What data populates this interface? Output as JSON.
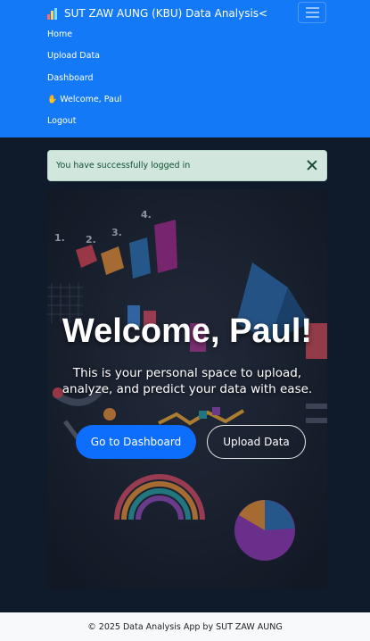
{
  "navbar": {
    "brand_text": "SUT ZAW AUNG (KBU) Data Analysis<",
    "brand_icon": "bar-chart-icon",
    "links": [
      {
        "label": "Home"
      },
      {
        "label": "Upload Data"
      },
      {
        "label": "Dashboard"
      },
      {
        "label": "Welcome, Paul",
        "icon": "waving-hand-icon"
      },
      {
        "label": "Logout"
      }
    ],
    "toggler_icon": "hamburger-menu-icon"
  },
  "alert": {
    "message": "You have successfully logged in",
    "close_icon": "close-icon"
  },
  "hero": {
    "title": "Welcome, Paul!",
    "subtitle": "This is your personal space to upload, analyze, and predict your data with ease.",
    "primary_button": "Go to Dashboard",
    "secondary_button": "Upload Data",
    "image_numbers": [
      "1.",
      "2.",
      "3.",
      "4."
    ]
  },
  "footer": {
    "text": "© 2025 Data Analysis App by SUT ZAW AUNG"
  },
  "colors": {
    "navbar": "#1479f7",
    "page_background": "#0f1b2a",
    "alert_background": "#d1e7dd",
    "alert_text": "#0f5132",
    "primary_button": "#0d6efd",
    "footer_background": "#f8f9fa"
  }
}
